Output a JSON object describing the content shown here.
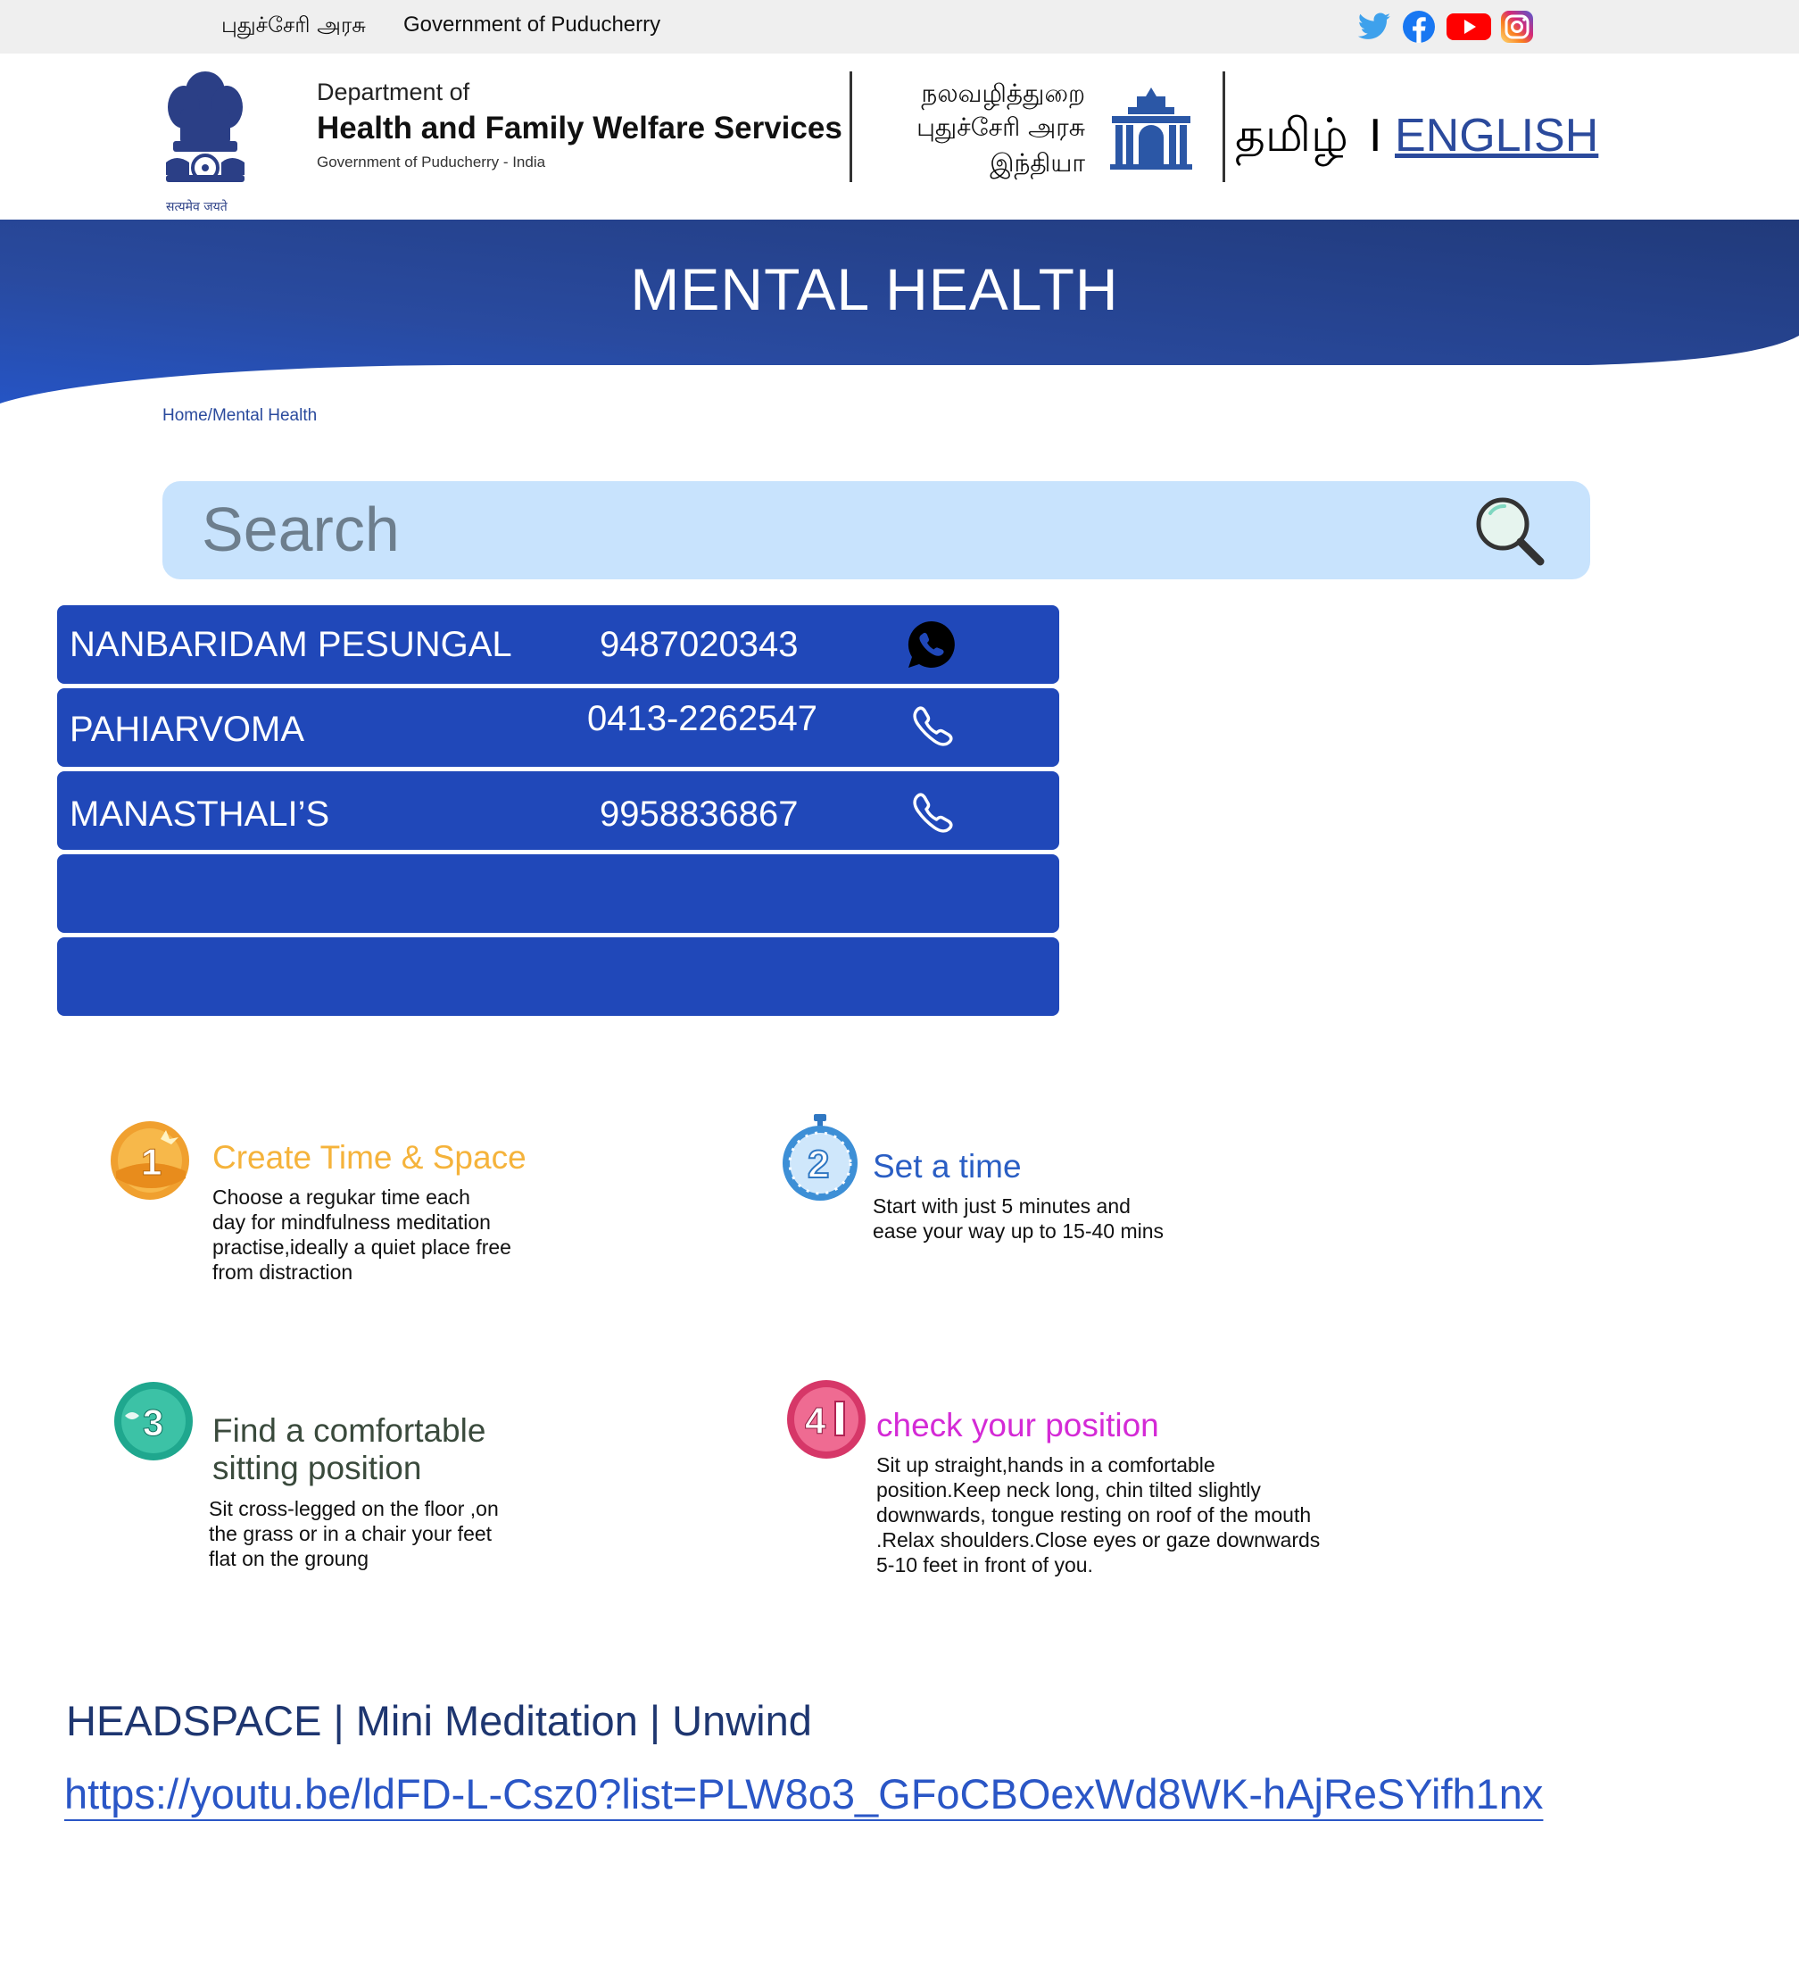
{
  "topbar": {
    "gov_tamil": "புதுச்சேரி அரசு",
    "gov_english": "Government of Puducherry",
    "social_icons": [
      "twitter-icon",
      "facebook-icon",
      "youtube-icon",
      "instagram-icon"
    ]
  },
  "header": {
    "emblem_motto": "सत्यमेव जयते",
    "dept_line1": "Department of",
    "dept_line2": "Health and Family Welfare Services",
    "dept_line3": "Government of Puducherry - India",
    "tamil_line1": "நலவழித்துறை",
    "tamil_line2": "புதுச்சேரி அரசு",
    "tamil_line3": "இந்தியா",
    "lang_tamil": "தமிழ்",
    "lang_separator": "I",
    "lang_english": "ENGLISH"
  },
  "banner": {
    "title": "MENTAL HEALTH"
  },
  "breadcrumb": "Home/Mental Health",
  "search": {
    "placeholder": "Search"
  },
  "helplines": [
    {
      "name": "NANBARIDAM PESUNGAL",
      "number": "9487020343",
      "icon": "whatsapp-icon"
    },
    {
      "name": "PAHIARVOMA",
      "number": "0413-2262547",
      "icon": "phone-icon"
    },
    {
      "name": "MANASTHALI’S",
      "number": "9958836867",
      "icon": "phone-icon"
    },
    {
      "name": "",
      "number": "",
      "icon": ""
    },
    {
      "name": "",
      "number": "",
      "icon": ""
    }
  ],
  "steps": [
    {
      "number": "1",
      "title": "Create Time & Space",
      "color": "#f5b33b",
      "lines": [
        "Choose a regukar time each",
        "day  for mindfulness meditation",
        "practise,ideally a quiet place free",
        "from distraction"
      ]
    },
    {
      "number": "2",
      "title": "Set a time",
      "color": "#2a5ec4",
      "lines": [
        "Start  with just  5 minutes and",
        "ease your way up to 15-40 mins"
      ]
    },
    {
      "number": "3",
      "title_lines": [
        "Find a comfortable",
        "sitting position"
      ],
      "color": "#3a4a3c",
      "lines": [
        "Sit cross-legged on the floor ,on",
        "the grass or in a chair your feet",
        "flat on the groung"
      ]
    },
    {
      "number": "4",
      "title": "check your position",
      "color": "#d42ad6",
      "lines": [
        "Sit up straight,hands in a comfortable",
        "position.Keep neck long, chin tilted slightly",
        "downwards, tongue resting on roof of the mouth",
        ".Relax shoulders.Close eyes or gaze downwards",
        "5-10 feet in front of you."
      ]
    }
  ],
  "video": {
    "title": "HEADSPACE | Mini Meditation | Unwind",
    "link": "https://youtu.be/ldFD-L-Csz0?list=PLW8o3_GFoCBOexWd8WK-hAjReSYifh1nx"
  },
  "colors": {
    "banner": "#27449a",
    "row": "#2048b9",
    "search_bg": "#c8e3fd",
    "link": "#2a56c6"
  }
}
